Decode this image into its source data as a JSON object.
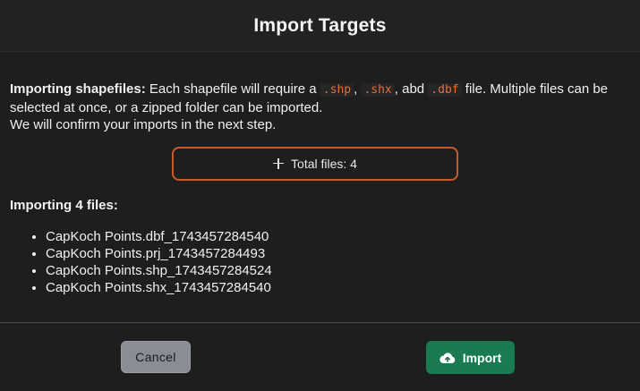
{
  "header": {
    "title": "Import Targets"
  },
  "intro": {
    "bold_label": "Importing shapefiles:",
    "text_part1": " Each shapefile will require a ",
    "ext_shp": ".shp",
    "sep1": ", ",
    "ext_shx": ".shx",
    "sep2": ", abd ",
    "ext_dbf": ".dbf",
    "text_part2": " file. Multiple files can be selected at once, or a zipped folder can be imported.",
    "line2": "We will confirm your imports in the next step."
  },
  "total_button": {
    "label": "Total files: 4",
    "icon": "plus-icon"
  },
  "files": {
    "heading": "Importing 4 files:",
    "items": [
      "CapKoch Points.dbf_1743457284540",
      "CapKoch Points.prj_1743457284493",
      "CapKoch Points.shp_1743457284524",
      "CapKoch Points.shx_1743457284540"
    ]
  },
  "footer": {
    "cancel_label": "Cancel",
    "import_label": "Import",
    "import_icon": "cloud-upload-icon"
  },
  "colors": {
    "accent_orange": "#c85a2a",
    "import_green": "#1a7a52",
    "cancel_gray": "#8a8d93"
  }
}
